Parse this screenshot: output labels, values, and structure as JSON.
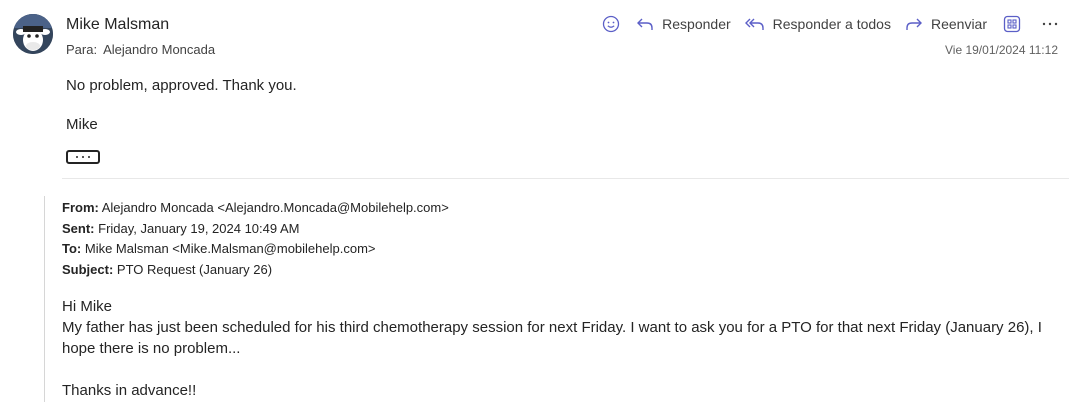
{
  "email": {
    "sender_name": "Mike Malsman",
    "to_label": "Para:",
    "to_name": "Alejandro Moncada",
    "date": "Vie 19/01/2024 11:12",
    "body_line": "No problem, approved. Thank you.",
    "signature": "Mike"
  },
  "toolbar": {
    "emoji_icon": "smiley-icon",
    "reply_label": "Responder",
    "reply_all_label": "Responder a todos",
    "forward_label": "Reenviar",
    "apps_icon": "apps-icon",
    "more_icon": "more-icon"
  },
  "quoted": {
    "from_label": "From:",
    "from_value": "Alejandro Moncada <Alejandro.Moncada@Mobilehelp.com>",
    "sent_label": "Sent:",
    "sent_value": "Friday, January 19, 2024 10:49 AM",
    "to_label": "To:",
    "to_value": "Mike Malsman <Mike.Malsman@mobilehelp.com>",
    "subject_label": "Subject:",
    "subject_value": "PTO Request (January 26)",
    "greeting": "Hi Mike",
    "body": "My father has just been scheduled for his third chemotherapy session for next Friday. I want to ask you for a PTO for that next Friday (January 26), I hope there is no problem...",
    "closing": "Thanks in advance!!"
  },
  "colors": {
    "accent": "#5b5fc7",
    "text": "#242424",
    "muted": "#616161"
  }
}
